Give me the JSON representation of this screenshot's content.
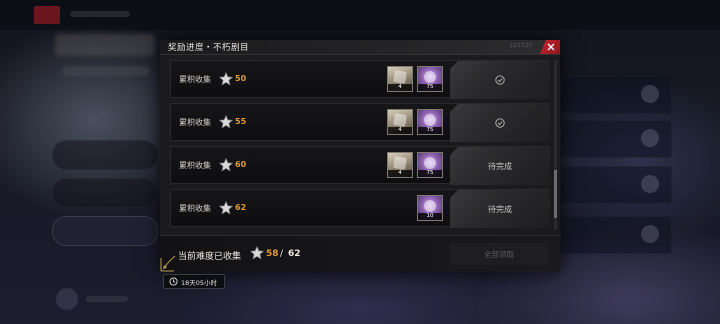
{
  "dialog": {
    "title": "奖励进度・不朽剧目",
    "header_tag": "12/17/23"
  },
  "milestones": [
    {
      "label": "累积收集",
      "threshold": "50",
      "rewards": [
        {
          "type": "gold",
          "count": "4"
        },
        {
          "type": "purple",
          "count": "75"
        }
      ],
      "status": "claimed",
      "status_text": ""
    },
    {
      "label": "累积收集",
      "threshold": "55",
      "rewards": [
        {
          "type": "gold",
          "count": "4"
        },
        {
          "type": "purple",
          "count": "75"
        }
      ],
      "status": "claimed",
      "status_text": ""
    },
    {
      "label": "累积收集",
      "threshold": "60",
      "rewards": [
        {
          "type": "gold",
          "count": "4"
        },
        {
          "type": "purple",
          "count": "75"
        }
      ],
      "status": "pending",
      "status_text": "待完成"
    },
    {
      "label": "累积收集",
      "threshold": "62",
      "rewards": [
        {
          "type": "purple",
          "count": "10"
        }
      ],
      "status": "pending",
      "status_text": "待完成"
    }
  ],
  "footer": {
    "label": "当前难度已收集",
    "current": "58",
    "separator": "/",
    "total": "62",
    "claim_all": "全部领取"
  },
  "timer": {
    "text": "18天05小时"
  },
  "colors": {
    "accent_orange": "#e29a38",
    "close_red": "#c92630"
  },
  "icons": {
    "star": "star-icon",
    "check": "check-circle-icon",
    "close": "close-icon",
    "clock": "clock-icon"
  }
}
